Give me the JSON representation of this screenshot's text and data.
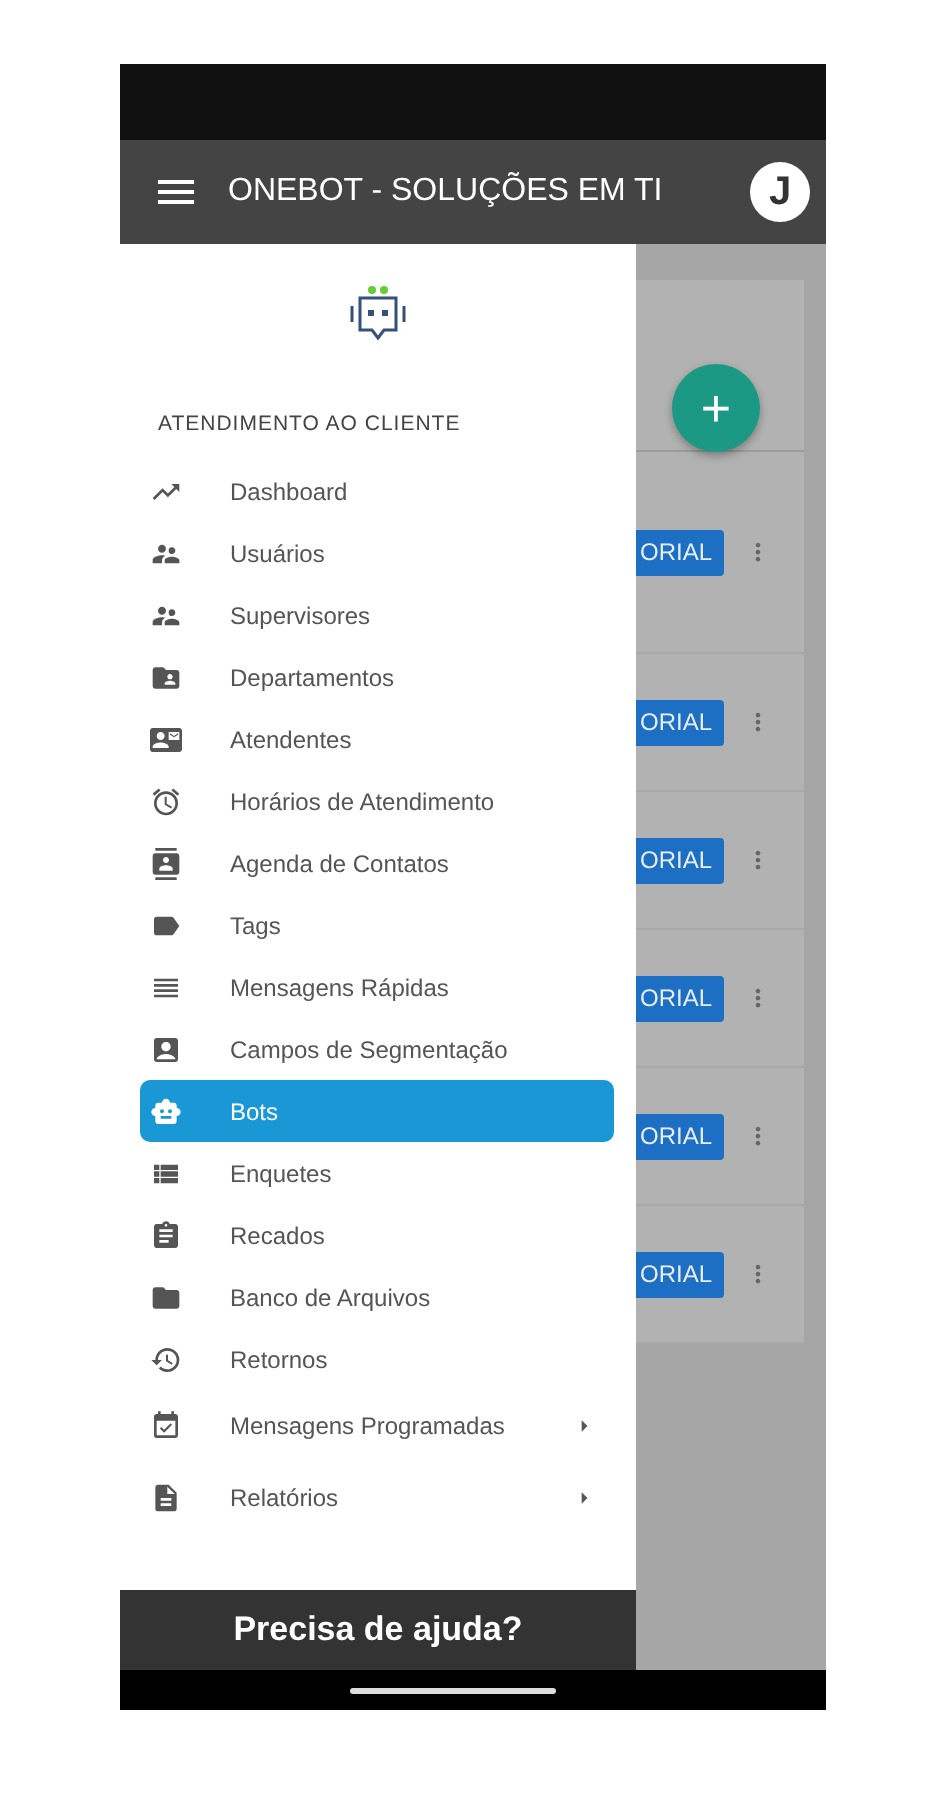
{
  "app_bar": {
    "title": "ONEBOT - SOLUÇÕES EM TI",
    "avatar": "J"
  },
  "drawer": {
    "section": "ATENDIMENTO AO CLIENTE",
    "items": [
      {
        "label": "Dashboard",
        "selected": false,
        "expandable": false
      },
      {
        "label": "Usuários",
        "selected": false,
        "expandable": false
      },
      {
        "label": "Supervisores",
        "selected": false,
        "expandable": false
      },
      {
        "label": "Departamentos",
        "selected": false,
        "expandable": false
      },
      {
        "label": "Atendentes",
        "selected": false,
        "expandable": false
      },
      {
        "label": "Horários de Atendimento",
        "selected": false,
        "expandable": false
      },
      {
        "label": "Agenda de Contatos",
        "selected": false,
        "expandable": false
      },
      {
        "label": "Tags",
        "selected": false,
        "expandable": false
      },
      {
        "label": "Mensagens Rápidas",
        "selected": false,
        "expandable": false
      },
      {
        "label": "Campos de Segmentação",
        "selected": false,
        "expandable": false
      },
      {
        "label": "Bots",
        "selected": true,
        "expandable": false
      },
      {
        "label": "Enquetes",
        "selected": false,
        "expandable": false
      },
      {
        "label": "Recados",
        "selected": false,
        "expandable": false
      },
      {
        "label": "Banco de Arquivos",
        "selected": false,
        "expandable": false
      },
      {
        "label": "Retornos",
        "selected": false,
        "expandable": false
      },
      {
        "label": "Mensagens Programadas",
        "selected": false,
        "expandable": true
      },
      {
        "label": "Relatórios",
        "selected": false,
        "expandable": true
      }
    ],
    "help": "Precisa de ajuda?"
  },
  "content": {
    "fab": "+",
    "rows": [
      {
        "button": "ORIAL"
      },
      {
        "button": "ORIAL"
      },
      {
        "button": "ORIAL"
      },
      {
        "button": "ORIAL"
      },
      {
        "button": "ORIAL"
      },
      {
        "button": "ORIAL"
      }
    ]
  }
}
